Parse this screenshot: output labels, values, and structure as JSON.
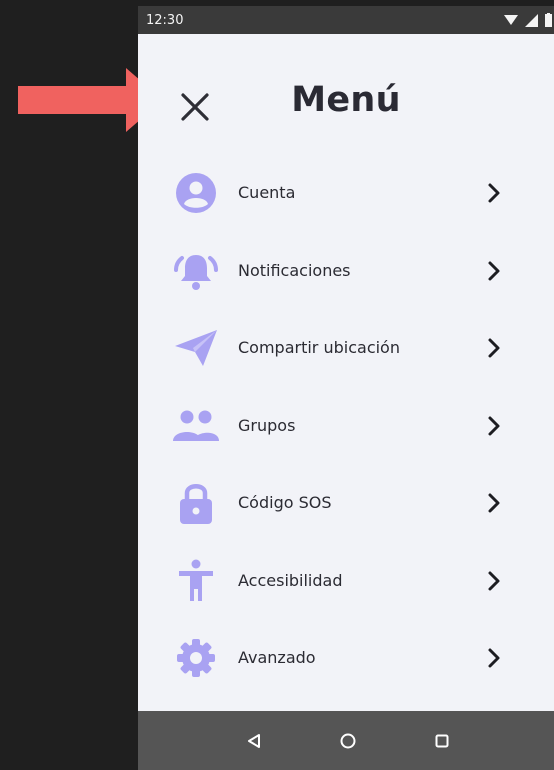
{
  "status_bar": {
    "time": "12:30"
  },
  "header": {
    "title": "Menú",
    "close_icon": "close-icon"
  },
  "annotation": {
    "color": "#f0625f",
    "icon": "arrow-right-icon"
  },
  "accent_color": "#a9a2f2",
  "menu": {
    "items": [
      {
        "label": "Cuenta",
        "icon": "account-icon"
      },
      {
        "label": "Notificaciones",
        "icon": "bell-ring-icon"
      },
      {
        "label": "Compartir ubicación",
        "icon": "send-icon"
      },
      {
        "label": "Grupos",
        "icon": "group-icon"
      },
      {
        "label": "Código SOS",
        "icon": "lock-icon"
      },
      {
        "label": "Accesibilidad",
        "icon": "accessibility-icon"
      },
      {
        "label": "Avanzado",
        "icon": "gear-icon"
      }
    ]
  },
  "nav_bar": {
    "buttons": [
      "back-icon",
      "home-icon",
      "recents-icon"
    ]
  }
}
